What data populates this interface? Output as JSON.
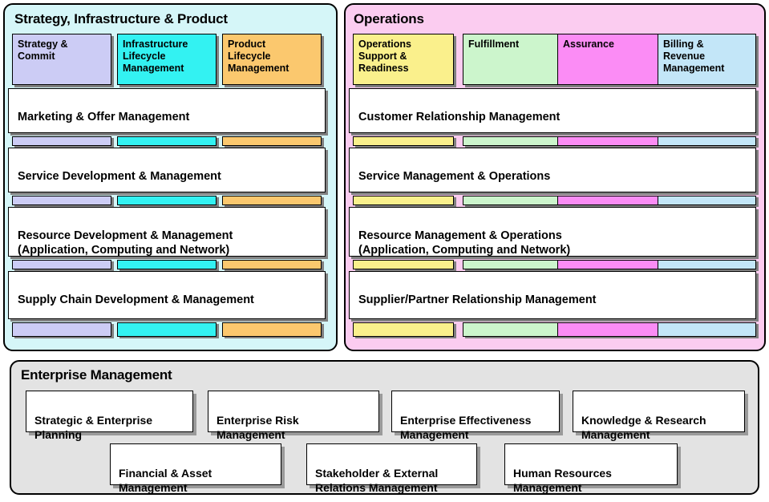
{
  "diagram": {
    "title": "eTOM Business Process Framework Level 1",
    "colors": {
      "sip_panel_bg": "#D5F6F8",
      "ops_panel_bg": "#FBCCF0",
      "em_panel_bg": "#E3E3E3",
      "strategy_commit": "#CCCCF5",
      "infrastructure_lifecycle": "#33F2F2",
      "product_lifecycle": "#FBC86E",
      "operations_support": "#FAF08C",
      "fulfillment": "#CCF5CC",
      "assurance": "#FB8CF5",
      "billing_revenue": "#C3E6F8",
      "row_fill": "#FFFFFF",
      "shadow": "#808080",
      "border": "#000000"
    }
  },
  "sip": {
    "title": "Strategy, Infrastructure & Product",
    "columns": [
      {
        "label": "Strategy &\nCommit",
        "color": "#CCCCF5"
      },
      {
        "label": "Infrastructure\nLifecycle\nManagement",
        "color": "#33F2F2"
      },
      {
        "label": "Product\nLifecycle\nManagement",
        "color": "#FBC86E"
      }
    ],
    "rows": [
      {
        "label": "Marketing & Offer Management"
      },
      {
        "label": "Service Development & Management"
      },
      {
        "label": "Resource Development & Management\n  (Application, Computing and Network)"
      },
      {
        "label": "Supply Chain Development & Management"
      }
    ]
  },
  "operations": {
    "title": "Operations",
    "columns": [
      {
        "label": "Operations\nSupport &\nReadiness",
        "color": "#FAF08C"
      },
      {
        "label": "Fulfillment",
        "color": "#CCF5CC"
      },
      {
        "label": "Assurance",
        "color": "#FB8CF5"
      },
      {
        "label": "Billing &\nRevenue\nManagement",
        "color": "#C3E6F8"
      }
    ],
    "rows": [
      {
        "label": "Customer Relationship Management"
      },
      {
        "label": "Service Management & Operations"
      },
      {
        "label": "Resource Management & Operations\n  (Application, Computing and Network)"
      },
      {
        "label": "Supplier/Partner Relationship Management"
      }
    ]
  },
  "enterprise": {
    "title": "Enterprise Management",
    "row1": [
      {
        "label": "Strategic & Enterprise\nPlanning"
      },
      {
        "label": "Enterprise Risk\nManagement"
      },
      {
        "label": "Enterprise Effectiveness\nManagement"
      },
      {
        "label": "Knowledge & Research\nManagement"
      }
    ],
    "row2": [
      {
        "label": "Financial & Asset\nManagement"
      },
      {
        "label": "Stakeholder & External\nRelations Management"
      },
      {
        "label": "Human Resources\nManagement"
      }
    ]
  }
}
